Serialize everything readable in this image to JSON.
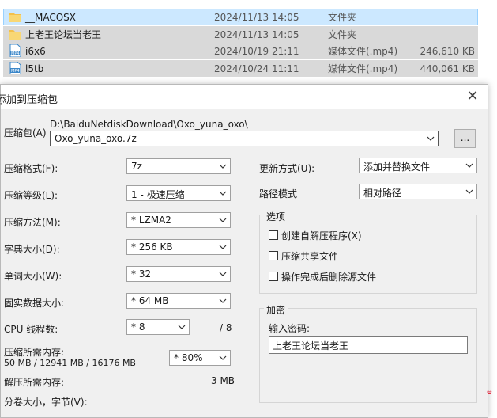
{
  "files": [
    {
      "name": "__MACOSX",
      "date": "2024/11/13 14:05",
      "type": "文件夹",
      "size": "",
      "icon": "folder-icon"
    },
    {
      "name": "上老王论坛当老王",
      "date": "2024/11/13 14:05",
      "type": "文件夹",
      "size": "",
      "icon": "folder-icon"
    },
    {
      "name": "i6x6",
      "date": "2024/10/19 21:11",
      "type": "媒体文件(.mp4)",
      "size": "246,610 KB",
      "icon": "mp4-file-icon"
    },
    {
      "name": "l5tb",
      "date": "2024/10/24 11:11",
      "type": "媒体文件(.mp4)",
      "size": "440,061 KB",
      "icon": "mp4-file-icon"
    }
  ],
  "mp4_badge": "MP4",
  "dialog": {
    "title": "添加到压缩包",
    "close": "✕",
    "archive_label": "压缩包(A)",
    "archive_path": "D:\\BaiduNetdiskDownload\\Oxo_yuna_oxo\\",
    "archive_name": "Oxo_yuna_oxo.7z",
    "browse": "...",
    "format_label": "压缩格式(F):",
    "format_value": "7z",
    "level_label": "压缩等级(L):",
    "level_value": "1 - 极速压缩",
    "method_label": "压缩方法(M):",
    "method_value": "* LZMA2",
    "dict_label": "字典大小(D):",
    "dict_value": "* 256 KB",
    "word_label": "单词大小(W):",
    "word_value": "* 32",
    "solid_label": "固实数据大小:",
    "solid_value": "* 64 MB",
    "cpu_label": "CPU 线程数:",
    "cpu_value": "* 8",
    "cpu_max": "/ 8",
    "mem_label": "压缩所需内存:",
    "mem_value": "50 MB / 12941 MB / 16176 MB",
    "mem_pct": "* 80%",
    "dmem_label": "解压所需内存:",
    "dmem_value": "3 MB",
    "cut_label": "分卷大小，字节(V):",
    "update_label": "更新方式(U):",
    "update_value": "添加并替换文件",
    "path_label": "路径模式",
    "path_value": "相对路径",
    "options_title": "选项",
    "opt_sfx": "创建自解压程序(X)",
    "opt_shared": "压缩共享文件",
    "opt_delete": "操作完成后删除源文件",
    "enc_title": "加密",
    "pwd_label": "输入密码:",
    "pwd_value": "上老王论坛当老王"
  },
  "colors": {
    "selection": "#cce8ff",
    "folder": "#f3c04c",
    "mp4": "#3b87c9",
    "dialog_bg": "#f0f0f0"
  }
}
